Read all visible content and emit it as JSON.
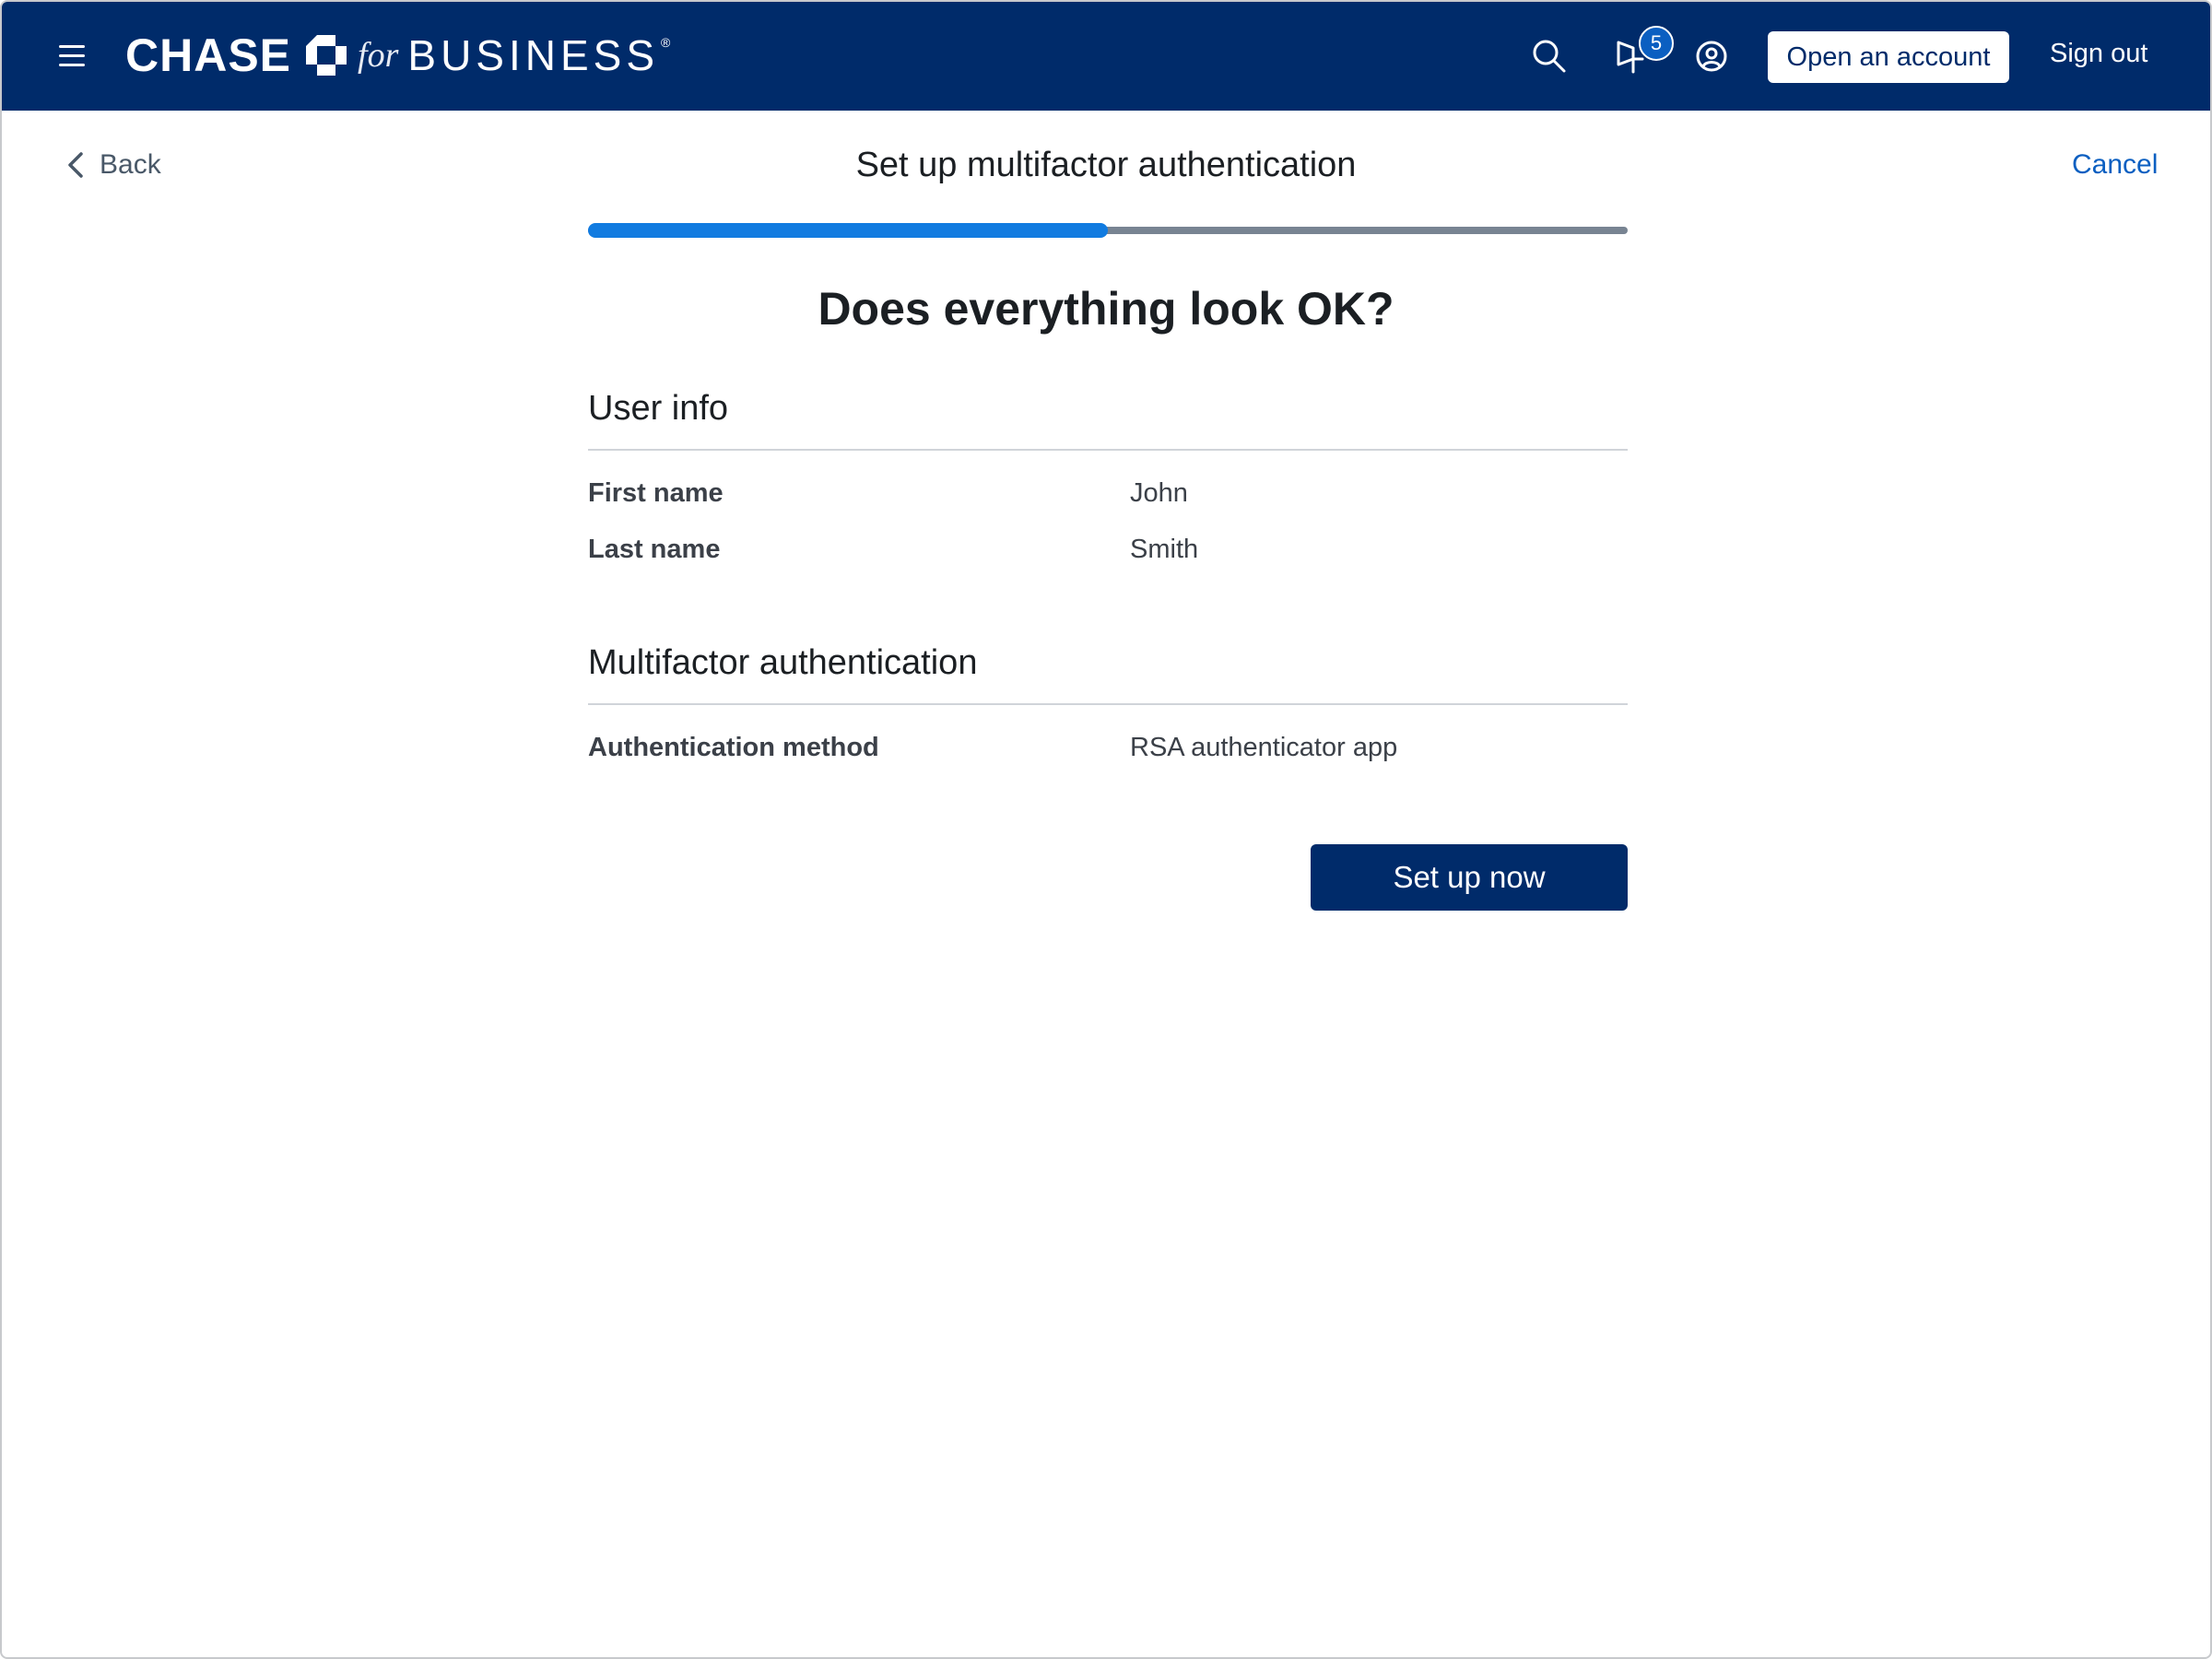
{
  "header": {
    "brand": {
      "chase": "CHASE",
      "for": "for",
      "business": "BUSINESS",
      "registered": "®"
    },
    "notifications_count": "5",
    "open_account_label": "Open an account",
    "sign_out_label": "Sign out",
    "icons": [
      "menu-icon",
      "search-icon",
      "notification-icon",
      "user-icon"
    ]
  },
  "nav": {
    "back_label": "Back",
    "title": "Set up multifactor authentication",
    "cancel_label": "Cancel"
  },
  "progress": {
    "completed_fraction": 0.5,
    "fill_color": "#117be0",
    "track_color": "#788492"
  },
  "main": {
    "heading": "Does everything look OK?",
    "sections": [
      {
        "title": "User info",
        "rows": [
          {
            "label": "First name",
            "value": "John"
          },
          {
            "label": "Last name",
            "value": "Smith"
          }
        ]
      },
      {
        "title": "Multifactor authentication",
        "rows": [
          {
            "label": "Authentication method",
            "value": "RSA authenticator app"
          }
        ]
      }
    ],
    "submit_label": "Set up now"
  },
  "colors": {
    "brand_navy": "#002b6a",
    "link_blue": "#0b5fc1"
  }
}
